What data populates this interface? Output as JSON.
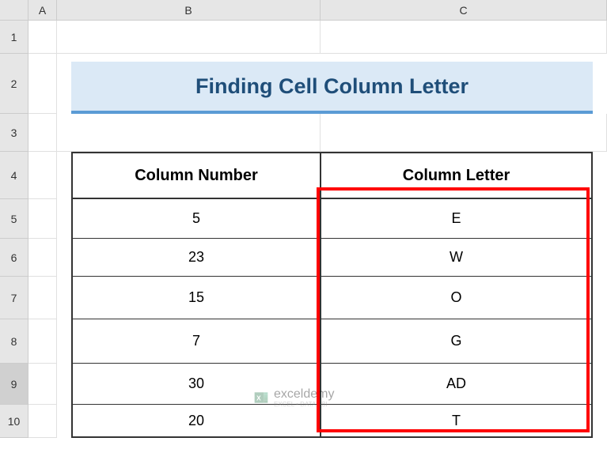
{
  "columnHeaders": [
    "A",
    "B",
    "C"
  ],
  "rowHeaders": [
    "1",
    "2",
    "3",
    "4",
    "5",
    "6",
    "7",
    "8",
    "9",
    "10"
  ],
  "selectedRow": "9",
  "title": "Finding Cell Column Letter",
  "tableHeaders": {
    "col1": "Column Number",
    "col2": "Column Letter"
  },
  "chart_data": {
    "type": "table",
    "title": "Finding Cell Column Letter",
    "columns": [
      "Column Number",
      "Column Letter"
    ],
    "rows": [
      {
        "number": "5",
        "letter": "E"
      },
      {
        "number": "23",
        "letter": "W"
      },
      {
        "number": "15",
        "letter": "O"
      },
      {
        "number": "7",
        "letter": "G"
      },
      {
        "number": "30",
        "letter": "AD"
      },
      {
        "number": "20",
        "letter": "T"
      }
    ]
  },
  "watermark": {
    "text": "exceldemy",
    "sub": "EXCEL • DATA • BI"
  }
}
